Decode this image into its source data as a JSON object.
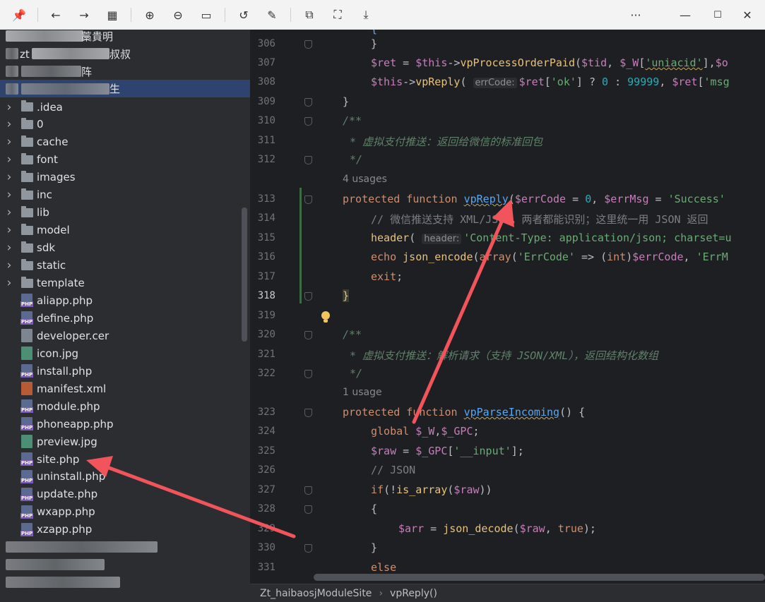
{
  "toolbar": {
    "buttons": [
      "pin-icon",
      "back-icon",
      "forward-icon",
      "grid-icon",
      "zoom-in-icon",
      "zoom-out-icon",
      "fit-icon",
      "rotate-icon",
      "edit-icon",
      "crop-icon",
      "ocr-icon",
      "save-icon"
    ],
    "more": "···",
    "minimize": "—",
    "maximize": "☐",
    "close": "✕"
  },
  "tree": {
    "items": [
      {
        "label": ".idea",
        "kind": "folder"
      },
      {
        "label": "0",
        "kind": "folder"
      },
      {
        "label": "cache",
        "kind": "folder"
      },
      {
        "label": "font",
        "kind": "folder"
      },
      {
        "label": "images",
        "kind": "folder"
      },
      {
        "label": "inc",
        "kind": "folder"
      },
      {
        "label": "lib",
        "kind": "folder"
      },
      {
        "label": "model",
        "kind": "folder"
      },
      {
        "label": "sdk",
        "kind": "folder"
      },
      {
        "label": "static",
        "kind": "folder"
      },
      {
        "label": "template",
        "kind": "folder"
      },
      {
        "label": "aliapp.php",
        "kind": "php"
      },
      {
        "label": "define.php",
        "kind": "php"
      },
      {
        "label": "developer.cer",
        "kind": "cer"
      },
      {
        "label": "icon.jpg",
        "kind": "img"
      },
      {
        "label": "install.php",
        "kind": "php"
      },
      {
        "label": "manifest.xml",
        "kind": "xml"
      },
      {
        "label": "module.php",
        "kind": "php"
      },
      {
        "label": "phoneapp.php",
        "kind": "php"
      },
      {
        "label": "preview.jpg",
        "kind": "img"
      },
      {
        "label": "site.php",
        "kind": "php"
      },
      {
        "label": "uninstall.php",
        "kind": "php"
      },
      {
        "label": "update.php",
        "kind": "php"
      },
      {
        "label": "wxapp.php",
        "kind": "php"
      },
      {
        "label": "xzapp.php",
        "kind": "php"
      }
    ],
    "blurred_top_1": "藁貴明",
    "blurred_top_2_prefix": "zt",
    "blurred_top_2_suffix": "叔叔",
    "blurred_top_3_suffix": "阵",
    "blurred_top_4_suffix": "生"
  },
  "editor": {
    "lines": [
      "306",
      "307",
      "308",
      "309",
      "310",
      "311",
      "312",
      "313",
      "314",
      "315",
      "316",
      "317",
      "318",
      "319",
      "320",
      "321",
      "322",
      "323",
      "324",
      "325",
      "326",
      "327",
      "328",
      "329",
      "330",
      "331"
    ],
    "usage_4": "4 usages",
    "usage_1": "1 usage",
    "hint_errcode": "errCode:",
    "hint_header": "header:",
    "comment_311": "* 虚拟支付推送：返回给微信的标准回包",
    "comment_314": "// 微信推送支持 XML/JSON，两者都能识别；这里统一用 JSON 返回",
    "comment_321": "* 虚拟支付推送：解析请求（支持 JSON/XML），返回结构化数组"
  },
  "breadcrumb": {
    "class": "Zt_haibaosjModuleSite",
    "method": "vpReply()"
  },
  "colors": {
    "arrow": "#f2545b",
    "editor_bg": "#1e1f22",
    "tree_bg": "#2b2d30",
    "selection": "#2e436e"
  }
}
